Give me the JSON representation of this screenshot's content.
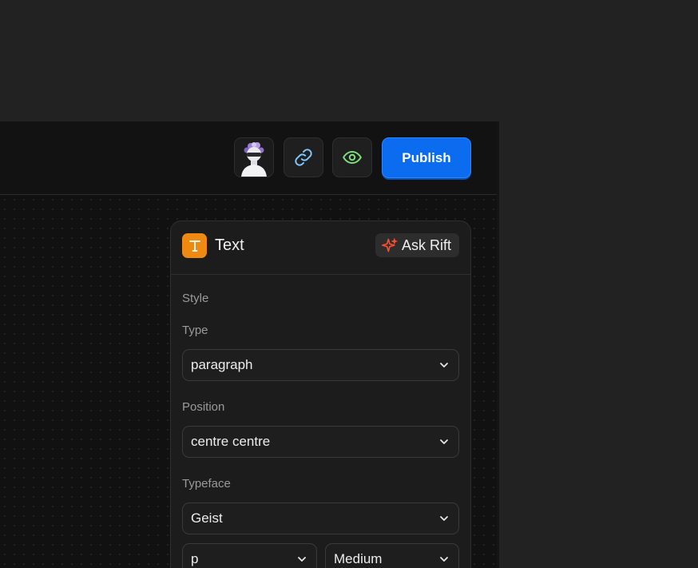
{
  "toolbar": {
    "publish_label": "Publish",
    "avatar_icon": "user-avatar",
    "link_icon": "link-icon",
    "preview_icon": "eye-icon"
  },
  "panel": {
    "title": "Text",
    "badge_icon": "text-T-icon",
    "ask_label": "Ask Rift",
    "style_label": "Style",
    "type_label": "Type",
    "type_value": "paragraph",
    "position_label": "Position",
    "position_value": "centre centre",
    "typeface_label": "Typeface",
    "typeface_value": "Geist",
    "size_value": "p",
    "weight_value": "Medium"
  },
  "colors": {
    "accent": "#0b6cf0",
    "badge": "#ee8a12",
    "link_icon": "#7ec8ff",
    "preview_icon": "#7ee07e",
    "ask_icon": "#ff4b2e"
  }
}
